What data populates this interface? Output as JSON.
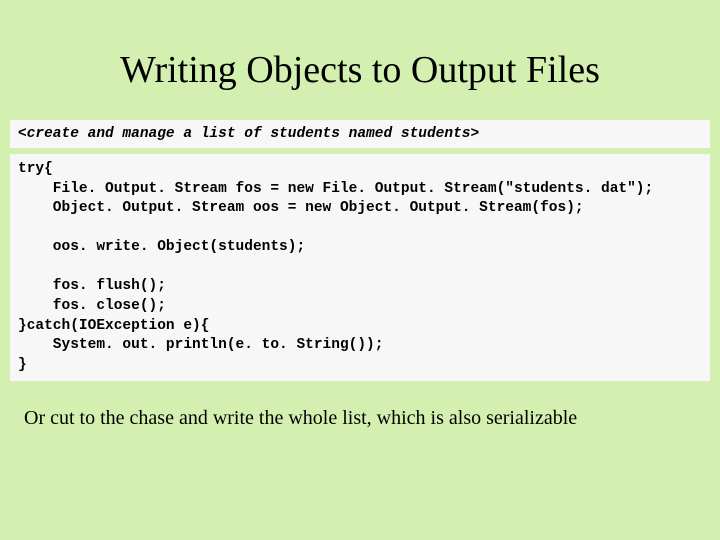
{
  "title": "Writing Objects to Output Files",
  "code1": "<create and manage a list of students named students>",
  "code2": "try{\n    File. Output. Stream fos = new File. Output. Stream(\"students. dat\");\n    Object. Output. Stream oos = new Object. Output. Stream(fos);\n\n    oos. write. Object(students);\n\n    fos. flush();\n    fos. close();\n}catch(IOException e){\n    System. out. println(e. to. String());\n}",
  "footer": "Or cut to the chase and write the whole list, which is also serializable"
}
